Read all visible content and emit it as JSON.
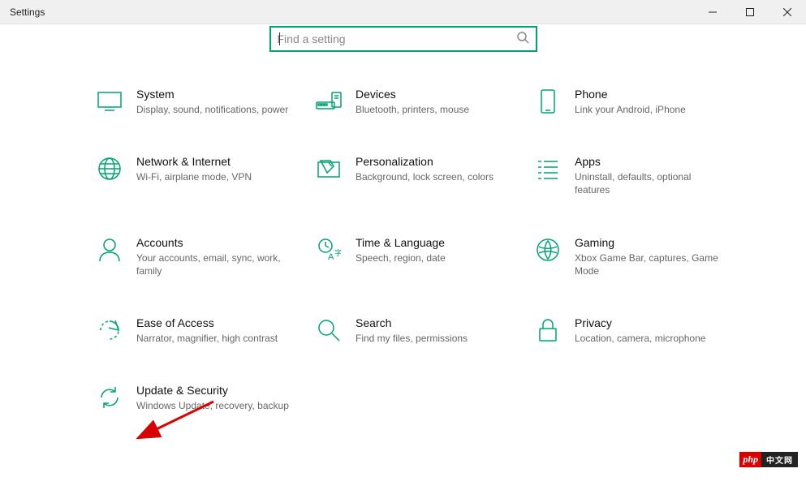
{
  "window": {
    "title": "Settings"
  },
  "search": {
    "placeholder": "Find a setting"
  },
  "categories": [
    {
      "id": "system",
      "title": "System",
      "desc": "Display, sound, notifications, power"
    },
    {
      "id": "devices",
      "title": "Devices",
      "desc": "Bluetooth, printers, mouse"
    },
    {
      "id": "phone",
      "title": "Phone",
      "desc": "Link your Android, iPhone"
    },
    {
      "id": "network",
      "title": "Network & Internet",
      "desc": "Wi-Fi, airplane mode, VPN"
    },
    {
      "id": "personalization",
      "title": "Personalization",
      "desc": "Background, lock screen, colors"
    },
    {
      "id": "apps",
      "title": "Apps",
      "desc": "Uninstall, defaults, optional features"
    },
    {
      "id": "accounts",
      "title": "Accounts",
      "desc": "Your accounts, email, sync, work, family"
    },
    {
      "id": "time",
      "title": "Time & Language",
      "desc": "Speech, region, date"
    },
    {
      "id": "gaming",
      "title": "Gaming",
      "desc": "Xbox Game Bar, captures, Game Mode"
    },
    {
      "id": "ease",
      "title": "Ease of Access",
      "desc": "Narrator, magnifier, high contrast"
    },
    {
      "id": "search-cat",
      "title": "Search",
      "desc": "Find my files, permissions"
    },
    {
      "id": "privacy",
      "title": "Privacy",
      "desc": "Location, camera, microphone"
    },
    {
      "id": "update",
      "title": "Update & Security",
      "desc": "Windows Update, recovery, backup"
    }
  ],
  "watermark": {
    "left": "php",
    "right": "中文网"
  }
}
